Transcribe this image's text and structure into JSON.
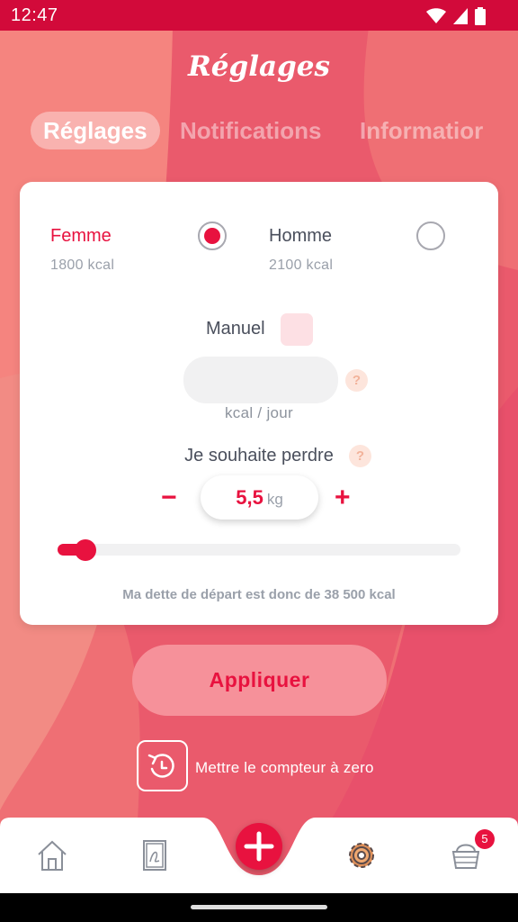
{
  "status_bar": {
    "time": "12:47",
    "wifi_icon": "wifi-icon",
    "signal_icon": "signal-icon",
    "battery_icon": "battery-icon"
  },
  "header": {
    "title": "Réglages"
  },
  "tabs": [
    {
      "label": "Réglages",
      "active": true
    },
    {
      "label": "Notifications",
      "active": false
    },
    {
      "label": "Informatior",
      "active": false
    }
  ],
  "settings": {
    "female": {
      "label": "Femme",
      "kcal": "1800 kcal",
      "selected": true
    },
    "male": {
      "label": "Homme",
      "kcal": "2100 kcal",
      "selected": false
    },
    "manual": {
      "label": "Manuel",
      "checked": false
    },
    "kcal_input": {
      "value": "",
      "unit": "kcal / jour"
    },
    "help_glyph": "?",
    "lose": {
      "label": "Je souhaite perdre",
      "value": "5,5",
      "unit": "kg",
      "minus": "−",
      "plus": "+",
      "slider_fraction": 0.07
    },
    "debt_text": "Ma dette de départ est donc de 38 500 kcal"
  },
  "actions": {
    "apply_label": "Appliquer",
    "reset_label": "Mettre le compteur à zero"
  },
  "bottom_nav": {
    "items": [
      {
        "icon": "home-icon"
      },
      {
        "icon": "journal-icon"
      },
      {
        "icon": "add-icon"
      },
      {
        "icon": "settings-gear-icon"
      },
      {
        "icon": "basket-icon"
      }
    ],
    "badge": "5"
  },
  "colors": {
    "accent": "#e8123f",
    "status_bar": "#d20a3a",
    "background": "#ef6f74"
  }
}
